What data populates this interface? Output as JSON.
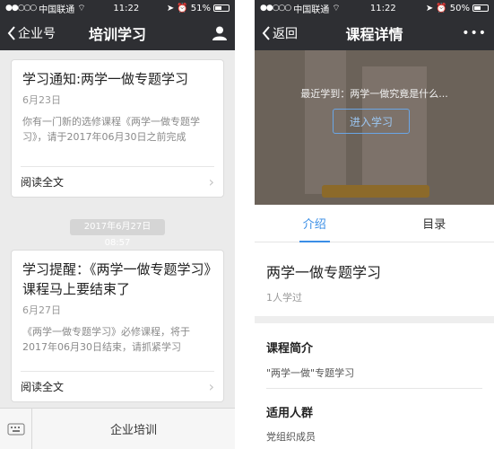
{
  "left": {
    "status": {
      "carrier": "中国联通",
      "time": "11:22",
      "battery": "51%",
      "battery_level": 0.51
    },
    "nav": {
      "back_label": "企业号",
      "title": "培训学习"
    },
    "cards": [
      {
        "title": "学习通知:两学一做专题学习",
        "date": "6月23日",
        "desc": "你有一门新的选修课程《两学一做专题学习》，请于2017年06月30日之前完成",
        "read_more": "阅读全文"
      },
      {
        "title": "学习提醒：《两学一做专题学习》课程马上要结束了",
        "date": "6月27日",
        "desc": "《两学一做专题学习》必修课程，将于2017年06月30日结束，请抓紧学习",
        "read_more": "阅读全文"
      }
    ],
    "timestamp": "2017年6月27日 08:57",
    "bottom_menu": "企业培训"
  },
  "right": {
    "status": {
      "carrier": "中国联通",
      "time": "11:22",
      "battery": "50%",
      "battery_level": 0.5
    },
    "nav": {
      "back_label": "返回",
      "title": "课程详情",
      "more": "•••"
    },
    "hero": {
      "recent_text": "最近学到：两学一做究竟是什么...",
      "enter_button": "进入学习"
    },
    "tabs": [
      {
        "label": "介绍",
        "active": true
      },
      {
        "label": "目录",
        "active": false
      }
    ],
    "course": {
      "title": "两学一做专题学习",
      "learners": "1人学过"
    },
    "intro": {
      "heading": "课程简介",
      "text": "\"两学一做\"专题学习"
    },
    "audience": {
      "heading": "适用人群",
      "text": "党组织成员"
    }
  },
  "colors": {
    "nav_bg": "#2e2f33",
    "accent": "#3a8ee6",
    "page_bg": "#ebebeb"
  }
}
